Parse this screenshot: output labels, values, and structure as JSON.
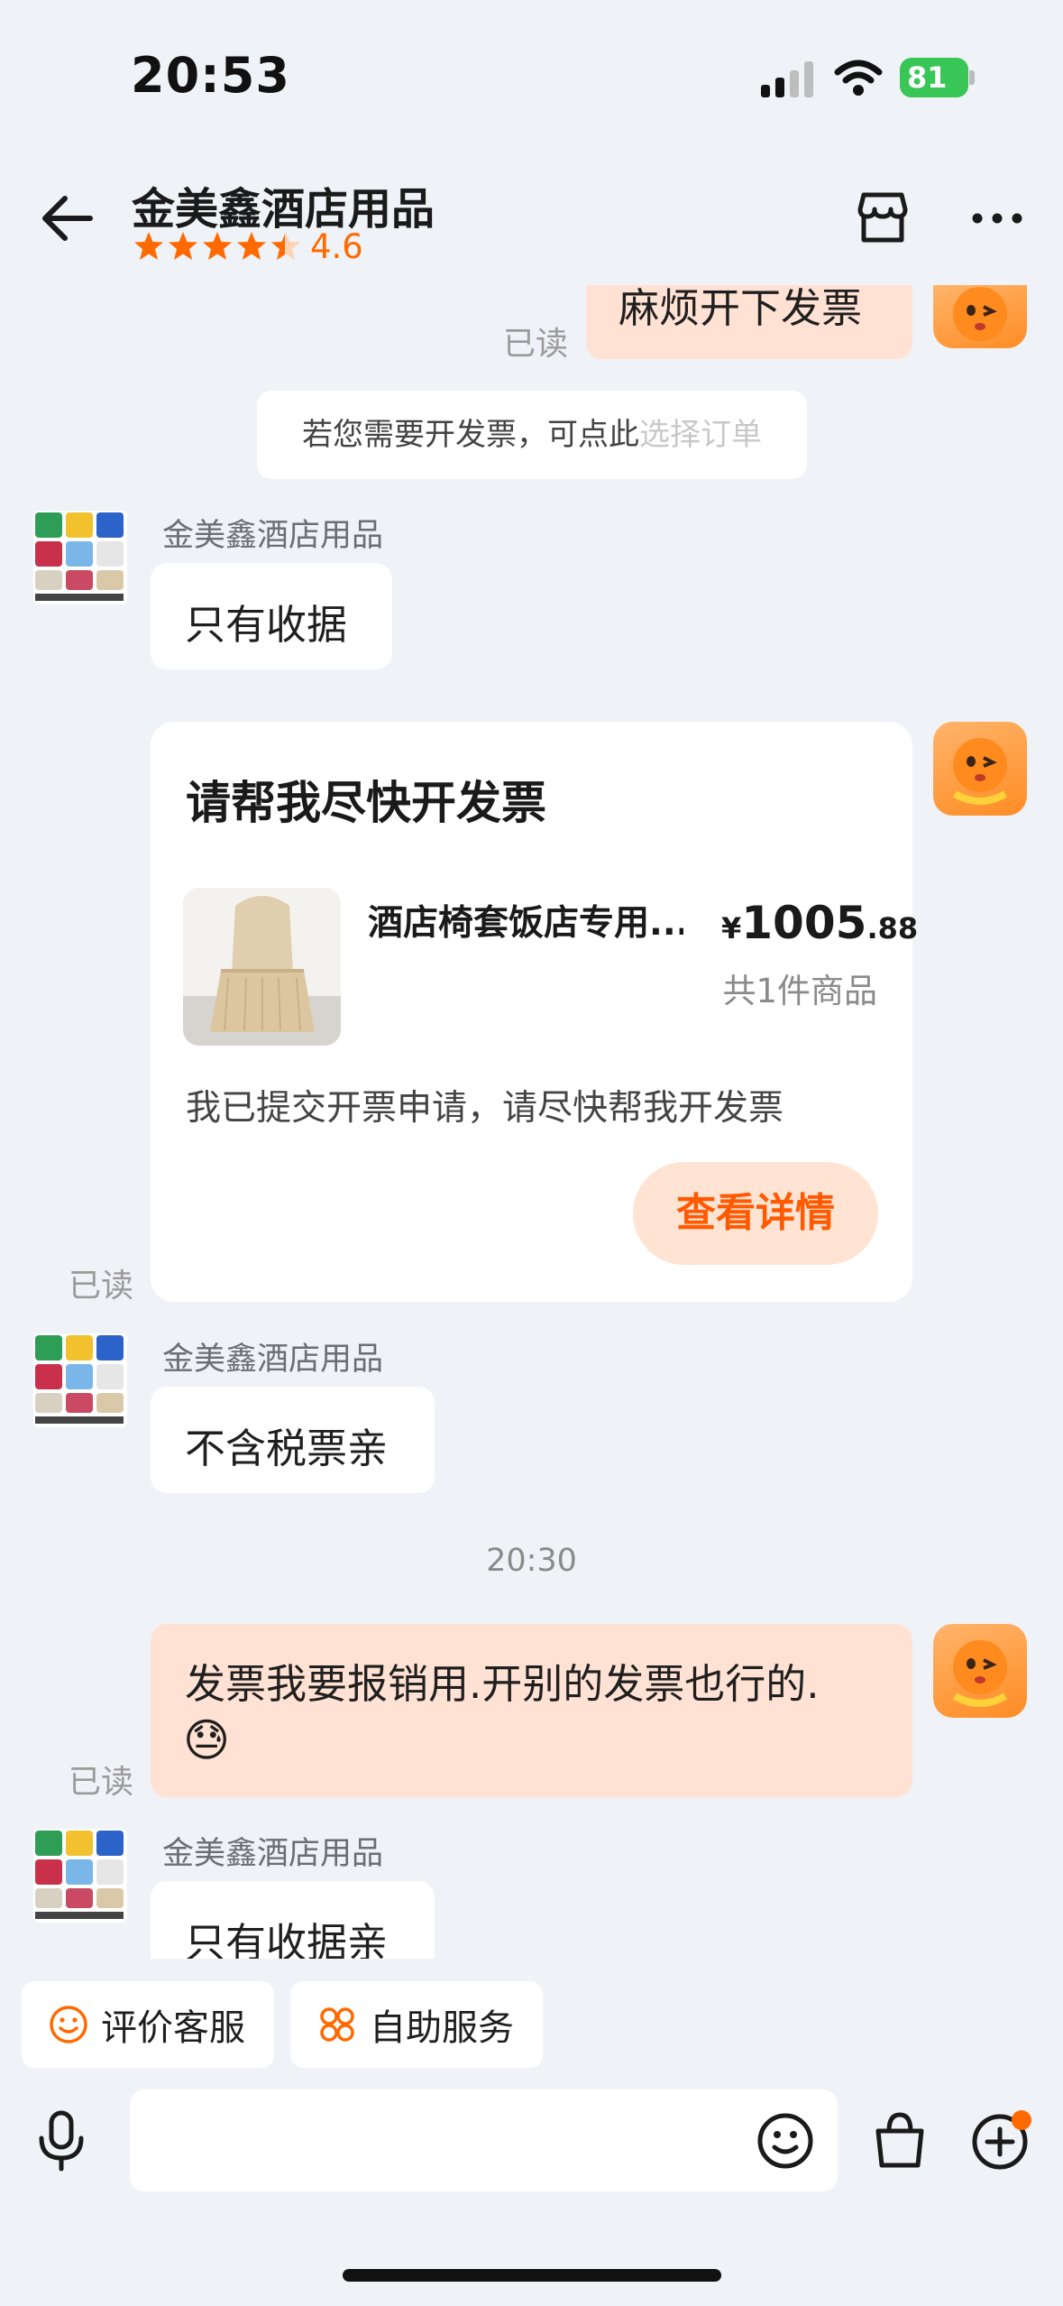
{
  "status_bar": {
    "time": "20:53",
    "battery": "81"
  },
  "header": {
    "title": "金美鑫酒店用品",
    "rating": "4.6",
    "rating_stars": 4.6
  },
  "messages": {
    "m1": {
      "text": "麻烦开下发票",
      "read": "已读"
    },
    "system_tip": {
      "text": "若您需要开发票，可点此",
      "link": "选择订单"
    },
    "m2": {
      "sender": "金美鑫酒店用品",
      "text": "只有收据"
    },
    "card": {
      "title": "请帮我尽快开发票",
      "product_name": "酒店椅套饭店专用...",
      "price_currency": "¥",
      "price_int": "1005",
      "price_dec": ".88",
      "quantity": "共1件商品",
      "desc": "我已提交开票申请，请尽快帮我开发票",
      "button": "查看详情",
      "read": "已读"
    },
    "m3": {
      "sender": "金美鑫酒店用品",
      "text": "不含税票亲"
    },
    "time_label": "20:30",
    "m4": {
      "text": "发票我要报销用.开别的发票也行的.",
      "emoji": "😓",
      "read": "已读"
    },
    "m5": {
      "sender": "金美鑫酒店用品",
      "text": "只有收据亲"
    }
  },
  "quick_actions": {
    "rate": "评价客服",
    "self_service": "自助服务"
  },
  "icons": {
    "back": "arrow-left-icon",
    "store": "store-icon",
    "more": "more-icon",
    "mic": "microphone-icon",
    "emoji": "emoji-icon",
    "bag": "shopping-bag-icon",
    "plus": "plus-circle-icon"
  },
  "colors": {
    "accent": "#ff6a00",
    "my_bubble": "#ffe2d3",
    "background": "#eff2f7",
    "notification_dot": "#ff6a00"
  }
}
